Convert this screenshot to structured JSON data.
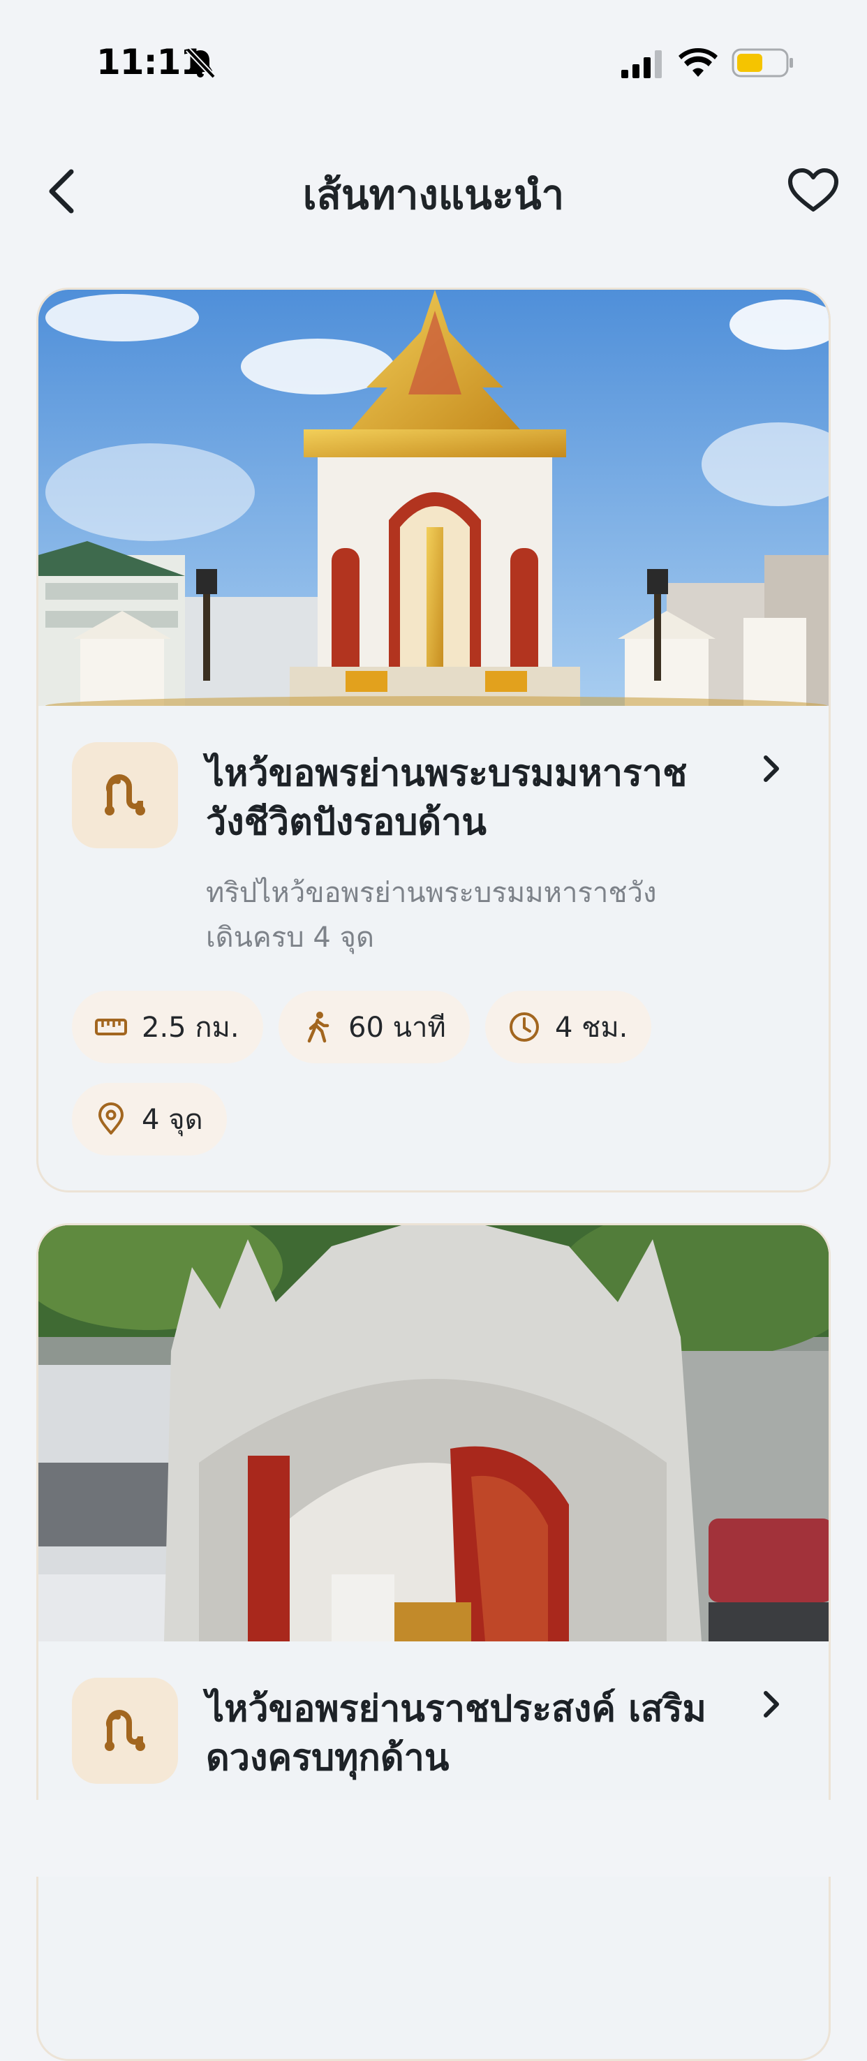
{
  "status_bar": {
    "time": "11:11",
    "bell_icon": "bell-slash-icon",
    "signal_icon": "cellular-signal-icon",
    "wifi_icon": "wifi-icon",
    "battery_icon": "battery-icon",
    "battery_color": "#f5c400",
    "battery_level": 0.55
  },
  "header": {
    "title": "เส้นทางแนะนำ",
    "back_icon": "chevron-left-icon",
    "favorite_icon": "heart-outline-icon"
  },
  "colors": {
    "accent": "#a2661f",
    "icon_bg": "#f5e8d6",
    "pill_bg": "#f8f1ea",
    "card_bg": "#f0f3f6"
  },
  "routes": [
    {
      "title_line1": "ไหว้ขอพรย่านพระบรมมหาราช",
      "title_line2": "วังชีวิตปังรอบด้าน",
      "desc_line1": "ทริปไหว้ขอพรย่านพระบรมมหาราชวัง",
      "desc_line2": "เดินครบ 4 จุด",
      "route_icon": "route-icon",
      "stats": [
        {
          "icon": "ruler-icon",
          "label": "2.5 กม."
        },
        {
          "icon": "walking-icon",
          "label": "60 นาที"
        },
        {
          "icon": "clock-icon",
          "label": "4 ชม."
        },
        {
          "icon": "location-pin-icon",
          "label": "4 จุด"
        }
      ]
    },
    {
      "title_line1": "ไหว้ขอพรย่านราชประสงค์ เสริม",
      "title_line2": "ดวงครบทุกด้าน",
      "route_icon": "route-icon"
    }
  ]
}
